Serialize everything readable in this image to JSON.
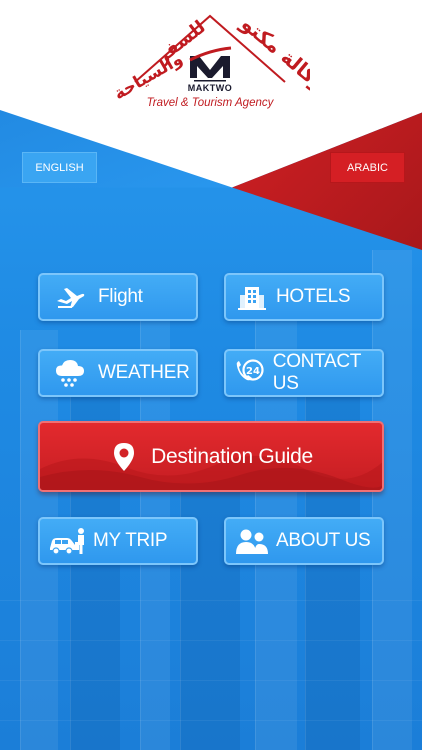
{
  "logo": {
    "arabic_text": "وكالة مكتو للسفر والسياحة",
    "brand": "MAKTWO",
    "tagline": "Travel & Tourism Agency"
  },
  "language": {
    "english_label": "ENGLISH",
    "arabic_label": "ARABIC"
  },
  "menu": {
    "flight": {
      "label": "Flight",
      "icon": "airplane-icon"
    },
    "hotels": {
      "label": "HOTELS",
      "icon": "hotel-building-icon"
    },
    "weather": {
      "label": "WEATHER",
      "icon": "rain-cloud-icon"
    },
    "contact": {
      "label": "CONTACT US",
      "icon": "phone-24-icon"
    },
    "destination": {
      "label": "Destination Guide",
      "icon": "location-pin-icon"
    },
    "mytrip": {
      "label": "MY TRIP",
      "icon": "traveler-car-icon"
    },
    "about": {
      "label": "ABOUT US",
      "icon": "people-icon"
    }
  },
  "colors": {
    "brand_red": "#d51f24",
    "brand_blue": "#2f98ee",
    "button_border": "#7cc6fb"
  }
}
